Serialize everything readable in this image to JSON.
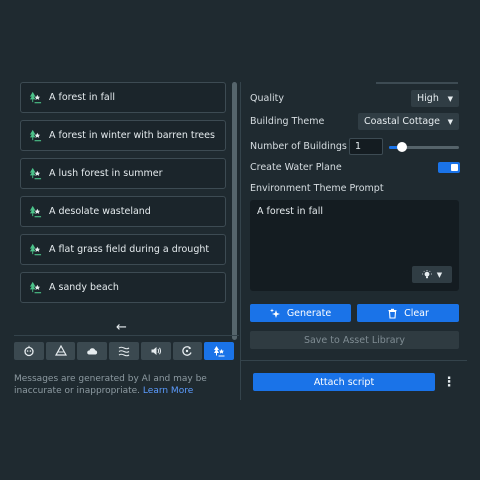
{
  "prompts": [
    "A forest in fall",
    "A forest in winter with barren trees",
    "A lush forest in summer",
    "A desolate wasteland",
    "A flat grass field during a drought",
    "A sandy beach"
  ],
  "toolbar": {
    "icons": [
      "robot-icon",
      "terrain-icon",
      "cloud-icon",
      "water-icon",
      "audio-icon",
      "replay-icon",
      "environment-icon"
    ],
    "active_index": 6
  },
  "back_arrow": "←",
  "disclaimer": {
    "text": "Messages are generated by AI and may be inaccurate or inappropriate.",
    "link": "Learn More"
  },
  "settings": {
    "quality_label": "Quality",
    "quality_value": "High",
    "building_theme_label": "Building Theme",
    "building_theme_value": "Coastal Cottage",
    "buildings_label": "Number of Buildings",
    "buildings_value": "1",
    "buildings_slider_fraction": 0.18,
    "water_plane_label": "Create Water Plane",
    "water_plane_enabled": true,
    "prompt_label": "Environment Theme Prompt",
    "prompt_value": "A forest in fall"
  },
  "actions": {
    "generate": "Generate",
    "clear": "Clear",
    "save": "Save to Asset Library",
    "attach": "Attach script"
  },
  "colors": {
    "accent": "#1a73e8",
    "background": "#1f2a30",
    "link": "#5c9cff"
  }
}
